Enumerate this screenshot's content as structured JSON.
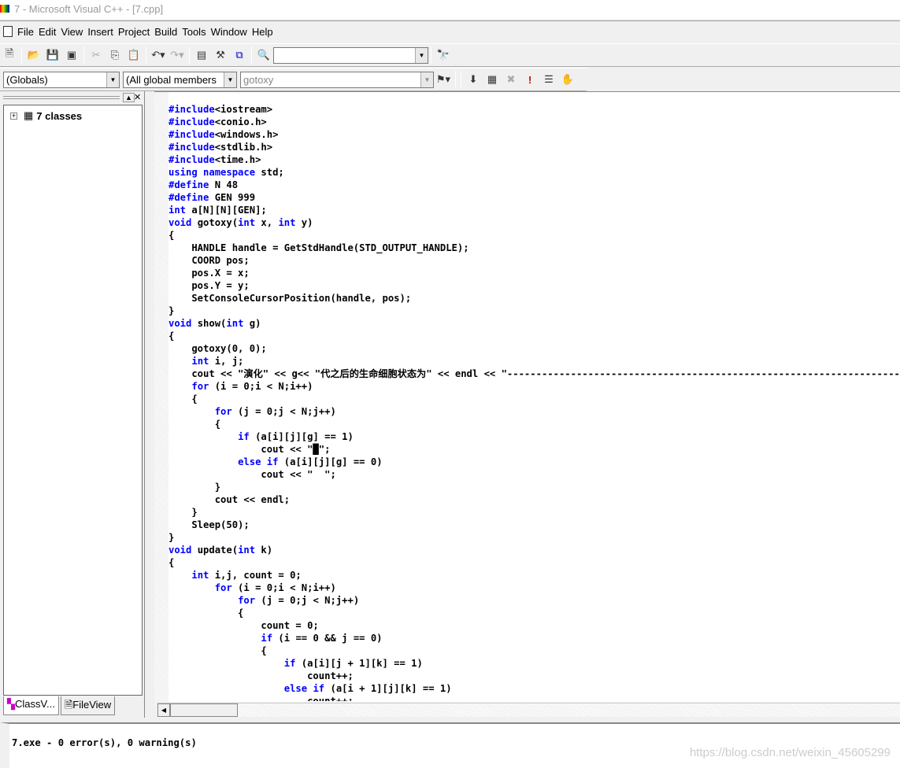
{
  "window": {
    "title": "7 - Microsoft Visual C++ - [7.cpp]"
  },
  "menu": [
    "File",
    "Edit",
    "View",
    "Insert",
    "Project",
    "Build",
    "Tools",
    "Window",
    "Help"
  ],
  "toolbar": {
    "find_combo_value": "",
    "icons": [
      "new-file",
      "open",
      "save",
      "save-all",
      "cut",
      "copy",
      "paste",
      "undo",
      "redo",
      "workspace",
      "output",
      "window-list",
      "find-in-files",
      "find"
    ]
  },
  "wizardbar": {
    "scope": "(Globals)",
    "filter": "(All global members",
    "member": "gotoxy",
    "icons": [
      "compile",
      "build",
      "stop-build",
      "execute",
      "go",
      "breakpoint"
    ]
  },
  "left_panel": {
    "tree_root": "7 classes",
    "tabs": [
      "ClassV...",
      "FileView"
    ]
  },
  "code": [
    [
      [
        "kw",
        "#include"
      ],
      [
        "",
        "<iostream>"
      ]
    ],
    [
      [
        "kw",
        "#include"
      ],
      [
        "",
        "<conio.h>"
      ]
    ],
    [
      [
        "kw",
        "#include"
      ],
      [
        "",
        "<windows.h>"
      ]
    ],
    [
      [
        "kw",
        "#include"
      ],
      [
        "",
        "<stdlib.h>"
      ]
    ],
    [
      [
        "kw",
        "#include"
      ],
      [
        "",
        "<time.h>"
      ]
    ],
    [
      [
        "kw",
        "using"
      ],
      [
        "",
        " "
      ],
      [
        "kw",
        "namespace"
      ],
      [
        "",
        " std;"
      ]
    ],
    [
      [
        "kw",
        "#define"
      ],
      [
        "",
        " N 48"
      ]
    ],
    [
      [
        "kw",
        "#define"
      ],
      [
        "",
        " GEN 999"
      ]
    ],
    [
      [
        "kw",
        "int"
      ],
      [
        "",
        " a[N][N][GEN];"
      ]
    ],
    [
      [
        "kw",
        "void"
      ],
      [
        "",
        " gotoxy("
      ],
      [
        "kw",
        "int"
      ],
      [
        "",
        " x, "
      ],
      [
        "kw",
        "int"
      ],
      [
        "",
        " y)"
      ]
    ],
    [
      [
        "",
        "{"
      ]
    ],
    [
      [
        "",
        "    HANDLE handle = GetStdHandle(STD_OUTPUT_HANDLE);"
      ]
    ],
    [
      [
        "",
        "    COORD pos;"
      ]
    ],
    [
      [
        "",
        "    pos.X = x;"
      ]
    ],
    [
      [
        "",
        "    pos.Y = y;"
      ]
    ],
    [
      [
        "",
        "    SetConsoleCursorPosition(handle, pos);"
      ]
    ],
    [
      [
        "",
        "}"
      ]
    ],
    [
      [
        "kw",
        "void"
      ],
      [
        "",
        " show("
      ],
      [
        "kw",
        "int"
      ],
      [
        "",
        " g)"
      ]
    ],
    [
      [
        "",
        "{"
      ]
    ],
    [
      [
        "",
        "    gotoxy(0, 0);"
      ]
    ],
    [
      [
        "",
        "    "
      ],
      [
        "kw",
        "int"
      ],
      [
        "",
        " i, j;"
      ]
    ],
    [
      [
        "",
        "    cout << \"演化\" << g<< \"代之后的生命细胞状态为\" << endl << \"------------------------------------------------------------------------------------------------"
      ]
    ],
    [
      [
        "",
        "    "
      ],
      [
        "kw",
        "for"
      ],
      [
        "",
        " (i = 0;i < N;i++)"
      ]
    ],
    [
      [
        "",
        "    {"
      ]
    ],
    [
      [
        "",
        "        "
      ],
      [
        "kw",
        "for"
      ],
      [
        "",
        " (j = 0;j < N;j++)"
      ]
    ],
    [
      [
        "",
        "        {"
      ]
    ],
    [
      [
        "",
        "            "
      ],
      [
        "kw",
        "if"
      ],
      [
        "",
        " (a[i][j][g] == 1)"
      ]
    ],
    [
      [
        "",
        "                cout << \"█\";"
      ]
    ],
    [
      [
        "",
        "            "
      ],
      [
        "kw",
        "else"
      ],
      [
        "",
        " "
      ],
      [
        "kw",
        "if"
      ],
      [
        "",
        " (a[i][j][g] == 0)"
      ]
    ],
    [
      [
        "",
        "                cout << \"  \";"
      ]
    ],
    [
      [
        "",
        "        }"
      ]
    ],
    [
      [
        "",
        "        cout << endl;"
      ]
    ],
    [
      [
        "",
        "    }"
      ]
    ],
    [
      [
        "",
        "    Sleep(50);"
      ]
    ],
    [
      [
        "",
        "}"
      ]
    ],
    [
      [
        "kw",
        "void"
      ],
      [
        "",
        " update("
      ],
      [
        "kw",
        "int"
      ],
      [
        "",
        " k)"
      ]
    ],
    [
      [
        "",
        "{"
      ]
    ],
    [
      [
        "",
        "    "
      ],
      [
        "kw",
        "int"
      ],
      [
        "",
        " i,j, count = 0;"
      ]
    ],
    [
      [
        "",
        "        "
      ],
      [
        "kw",
        "for"
      ],
      [
        "",
        " (i = 0;i < N;i++)"
      ]
    ],
    [
      [
        "",
        "            "
      ],
      [
        "kw",
        "for"
      ],
      [
        "",
        " (j = 0;j < N;j++)"
      ]
    ],
    [
      [
        "",
        "            {"
      ]
    ],
    [
      [
        "",
        "                count = 0;"
      ]
    ],
    [
      [
        "",
        "                "
      ],
      [
        "kw",
        "if"
      ],
      [
        "",
        " (i == 0 && j == 0)"
      ]
    ],
    [
      [
        "",
        "                {"
      ]
    ],
    [
      [
        "",
        "                    "
      ],
      [
        "kw",
        "if"
      ],
      [
        "",
        " (a[i][j + 1][k] == 1)"
      ]
    ],
    [
      [
        "",
        "                        count++;"
      ]
    ],
    [
      [
        "",
        "                    "
      ],
      [
        "kw",
        "else"
      ],
      [
        "",
        " "
      ],
      [
        "kw",
        "if"
      ],
      [
        "",
        " (a[i + 1][j][k] == 1)"
      ]
    ],
    [
      [
        "",
        "                        count++;"
      ]
    ]
  ],
  "output": {
    "text": "7.exe - 0 error(s), 0 warning(s)"
  },
  "watermark": "https://blog.csdn.net/weixin_45605299",
  "colors": {
    "keyword": "#0000ff",
    "text": "#000000"
  }
}
